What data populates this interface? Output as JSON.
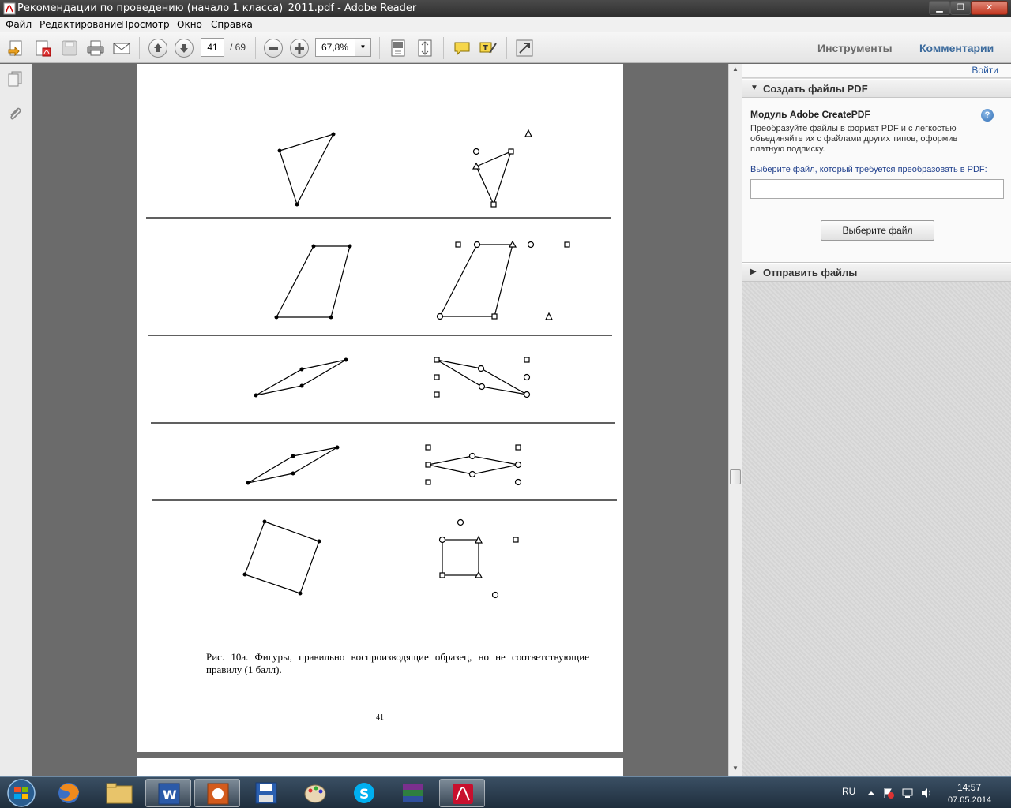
{
  "window": {
    "title": "Рекомендации по проведению (начало 1 класса)_2011.pdf - Adobe Reader"
  },
  "menu": {
    "file": "Файл",
    "edit": "Редактирование",
    "view": "Просмотр",
    "window": "Окно",
    "help": "Справка"
  },
  "toolbar": {
    "page_current": "41",
    "page_total": "/ 69",
    "zoom": "67,8%",
    "tools_label": "Инструменты",
    "comments_label": "Комментарии"
  },
  "document": {
    "caption": "Рис. 10а. Фигуры, правильно воспроизводящие образец, но не соответствующие правилу (1 балл).",
    "page_number": "41"
  },
  "panel": {
    "login": "Войти",
    "create_pdf_header": "Создать файлы PDF",
    "module_title": "Модуль Adobe CreatePDF",
    "module_desc": "Преобразуйте файлы в формат PDF и с легкостью объединяйте их с файлами других типов, оформив платную подписку.",
    "choose_label": "Выберите файл, который требуется преобразовать в PDF:",
    "choose_button": "Выберите файл",
    "send_files_header": "Отправить файлы"
  },
  "taskbar": {
    "language": "RU",
    "time": "14:57",
    "date": "07.05.2014"
  }
}
